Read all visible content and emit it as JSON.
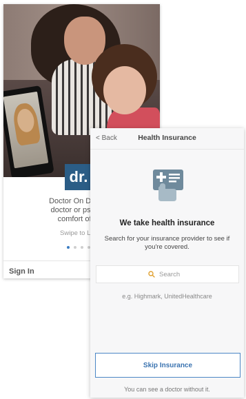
{
  "back_screen": {
    "logo_text": "dr.",
    "description_lines": [
      "Doctor On Demand",
      "doctor or psycholo",
      "comfort of you"
    ],
    "swipe_hint": "Swipe to Le",
    "sign_in_label": "Sign In",
    "page_dots": {
      "count": 4,
      "active_index": 0
    }
  },
  "front_screen": {
    "nav": {
      "back_label": "< Back",
      "title": "Health Insurance"
    },
    "icon": "insurance-card-hand-icon",
    "heading": "We take health insurance",
    "description": "Search for your insurance provider to see if you're covered.",
    "search": {
      "icon": "search-icon",
      "placeholder": "Search"
    },
    "example_text": "e.g. Highmark, UnitedHealthcare",
    "skip_button_label": "Skip Insurance",
    "skip_note": "You can see a doctor without it."
  },
  "colors": {
    "brand_blue": "#2b5d86",
    "accent_blue": "#4a86c5",
    "search_icon": "#e0a030"
  }
}
